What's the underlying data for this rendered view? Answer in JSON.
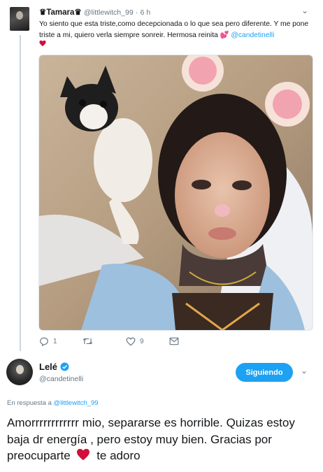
{
  "reply": {
    "name": "Tamara",
    "name_decor": "♛",
    "handle": "@littlewitch_99",
    "separator": "·",
    "time": "6 h",
    "text_part1": "Yo siento que esta triste,como decepcionada o lo que sea pero diferente. Y me pone triste a mi, quiero verla siempre sonreir. Hermosa reinita",
    "emoji_hearts": "💕",
    "mention": "@candetinelli",
    "reply_count": "1",
    "retweet_count": "",
    "like_count": "9"
  },
  "main_tweet": {
    "name": "Lelé",
    "handle": "@candetinelli",
    "follow_label": "Siguiendo",
    "in_reply_prefix": "En respuesta a",
    "in_reply_handle": "@littlewitch_99",
    "text_before_heart": "Amorrrrrrrrrrrr mio, separarse es horrible. Quizas estoy baja dr energía , pero estoy muy bien. Gracias por preocuparte",
    "text_after_heart": "te adoro"
  },
  "colors": {
    "accent": "#1da1f2",
    "heart": "#e0245e",
    "muted": "#657786"
  },
  "icons": {
    "reply": "reply-icon",
    "retweet": "retweet-icon",
    "like": "heart-outline-icon",
    "dm": "envelope-icon",
    "verified": "verified-badge-icon",
    "more": "chevron-down-icon"
  }
}
